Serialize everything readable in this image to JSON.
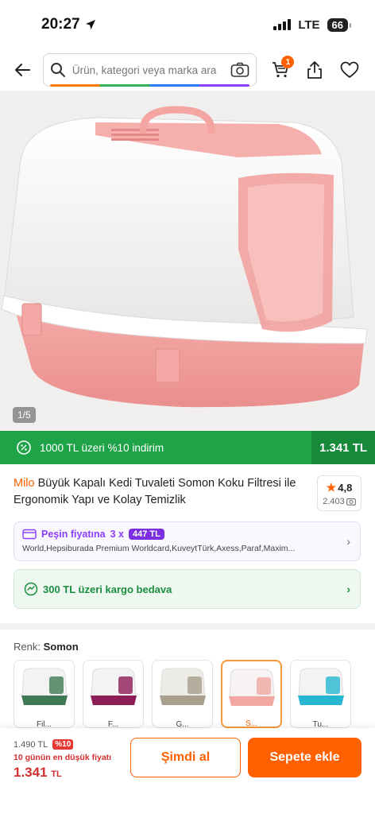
{
  "status_bar": {
    "time": "20:27",
    "network": "LTE",
    "battery": "66"
  },
  "header": {
    "search_placeholder": "Ürün, kategori veya marka ara",
    "cart_badge": "1"
  },
  "gallery": {
    "counter": "1/5"
  },
  "promo": {
    "text": "1000 TL üzeri %10 indirim",
    "price": "1.341 TL"
  },
  "product": {
    "brand": "Milo",
    "title": "Büyük Kapalı Kedi Tuvaleti Somon Koku Filtresi ile Ergonomik Yapı ve Kolay Temizlik",
    "rating": "4,8",
    "review_count": "2.403"
  },
  "installment": {
    "label": "Peşin fiyatına",
    "count": "3 x",
    "amount": "447 TL",
    "cards": "World,Hepsiburada Premium Worldcard,KuveytTürk,Axess,Paraf,Maxim..."
  },
  "shipping": {
    "text": "300 TL üzeri kargo bedava"
  },
  "color": {
    "label": "Renk:",
    "selected": "Somon",
    "options": [
      {
        "label": "Fil...",
        "box": "#f3f3f3",
        "base": "#3f7a55"
      },
      {
        "label": "F...",
        "box": "#f3f3f3",
        "base": "#8e1c57"
      },
      {
        "label": "G...",
        "box": "#ecebe6",
        "base": "#a89f8c"
      },
      {
        "label": "S...",
        "box": "#f6f3f2",
        "base": "#f3a7a3"
      },
      {
        "label": "Tu...",
        "box": "#f3f3f3",
        "base": "#26b7d0"
      }
    ]
  },
  "bottom_bar": {
    "old_price": "1.490 TL",
    "discount": "%10",
    "lowest_note": "10 günün en düşük fiyatı",
    "price": "1.341",
    "currency": "TL",
    "buy_now": "Şimdi al",
    "add_to_cart": "Sepete ekle"
  },
  "colors": {
    "accent": "#ff6000",
    "green": "#1fa349",
    "purple": "#7b2fe0"
  }
}
